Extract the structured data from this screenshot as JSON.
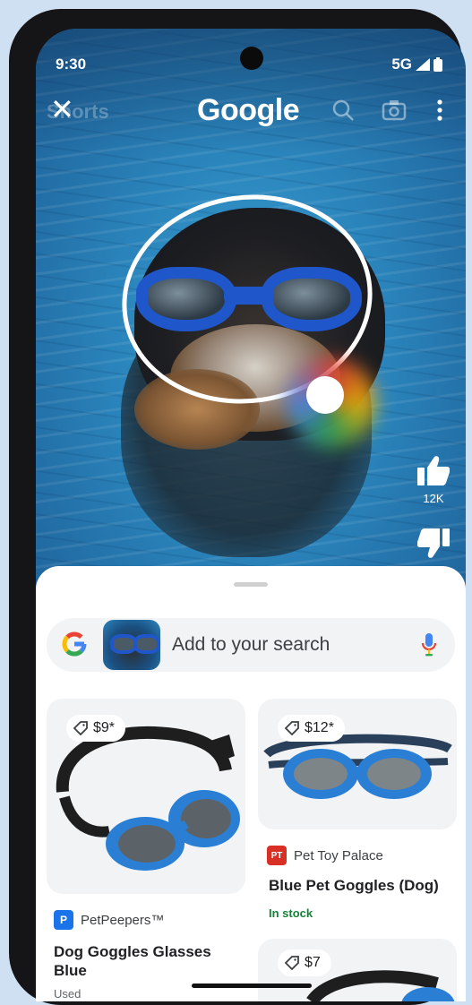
{
  "status_bar": {
    "time": "9:30",
    "network": "5G"
  },
  "top_bar": {
    "faint_text": "Shorts",
    "title": "Google"
  },
  "actions": {
    "like_count": "12K"
  },
  "search": {
    "placeholder": "Add to your search"
  },
  "results": [
    {
      "price": "$9*",
      "merchant": "PetPeepers™",
      "merchant_color": "#1a73e8",
      "merchant_initial": "P",
      "title": "Dog Goggles Glasses Blue",
      "availability": "Used"
    },
    {
      "price": "$12*",
      "merchant": "Pet Toy Palace",
      "merchant_color": "#d93025",
      "merchant_initial": "PT",
      "title": "Blue Pet Goggles (Dog)",
      "availability": "In stock"
    },
    {
      "price": "$7"
    }
  ],
  "colors": {
    "google_blue": "#4285f4",
    "google_red": "#ea4335",
    "google_yellow": "#fbbc05",
    "google_green": "#34a853",
    "goggle_blue": "#1f56c9"
  },
  "icons": [
    "close-icon",
    "search-icon",
    "camera-icon",
    "more-vert-icon",
    "thumb-up-icon",
    "thumb-down-icon",
    "google-g-icon",
    "mic-icon",
    "price-tag-icon",
    "signal-icon",
    "battery-icon"
  ]
}
